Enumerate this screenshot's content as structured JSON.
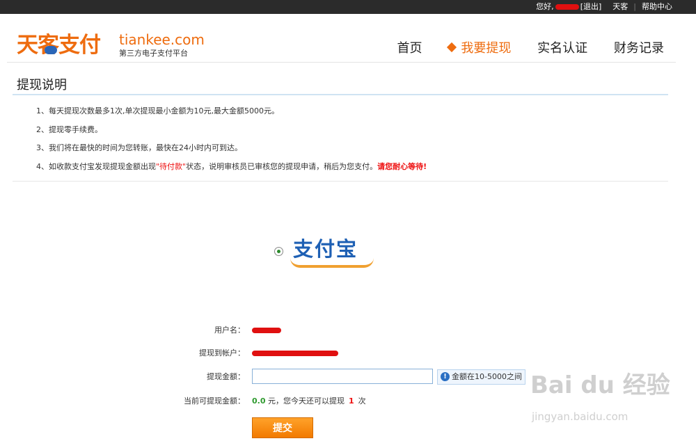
{
  "topbar": {
    "greeting": "您好,",
    "logout": "[退出]",
    "brand_link": "天客",
    "help": "帮助中心"
  },
  "logo": {
    "cn": "天客支付",
    "en": "tiankee.com",
    "sub": "第三方电子支付平台"
  },
  "nav": {
    "items": [
      {
        "label": "首页",
        "active": false
      },
      {
        "label": "我要提现",
        "active": true
      },
      {
        "label": "实名认证",
        "active": false
      },
      {
        "label": "财务记录",
        "active": false
      }
    ]
  },
  "section": {
    "title": "提现说明"
  },
  "notes": {
    "n1": "1、每天提现次数最多1次,单次提现最小金额为10元,最大金额5000元。",
    "n2": "2、提现零手续费。",
    "n3": "3、我们将在最快的时间为您转账，最快在24小时内可到达。",
    "n4_pre": "4、如收款支付宝发现提现金额出现",
    "n4_status": "\"待付款\"",
    "n4_mid": "状态，说明审核员已审核您的提现申请，稍后为您支付。",
    "n4_wait": "请您耐心等待!"
  },
  "payment": {
    "method": "支付宝"
  },
  "form": {
    "username_label": "用户名：",
    "account_label": "提现到帐户：",
    "amount_label": "提现金额：",
    "amount_value": "",
    "amount_hint": "金额在10-5000之间",
    "available_label": "当前可提现金额：",
    "available_amount": "0.0",
    "available_unit": "元，您今天还可以提现",
    "remaining_count": "1",
    "count_unit": "次",
    "submit": "提交"
  },
  "watermark": {
    "main": "Bai du 经验",
    "sub": "jingyan.baidu.com"
  },
  "colors": {
    "accent": "#ee6c0f",
    "topbar": "#2b2b2b",
    "alert_red": "#e11111",
    "link_blue": "#1e60b4",
    "ok_green": "#2f9a2f"
  }
}
